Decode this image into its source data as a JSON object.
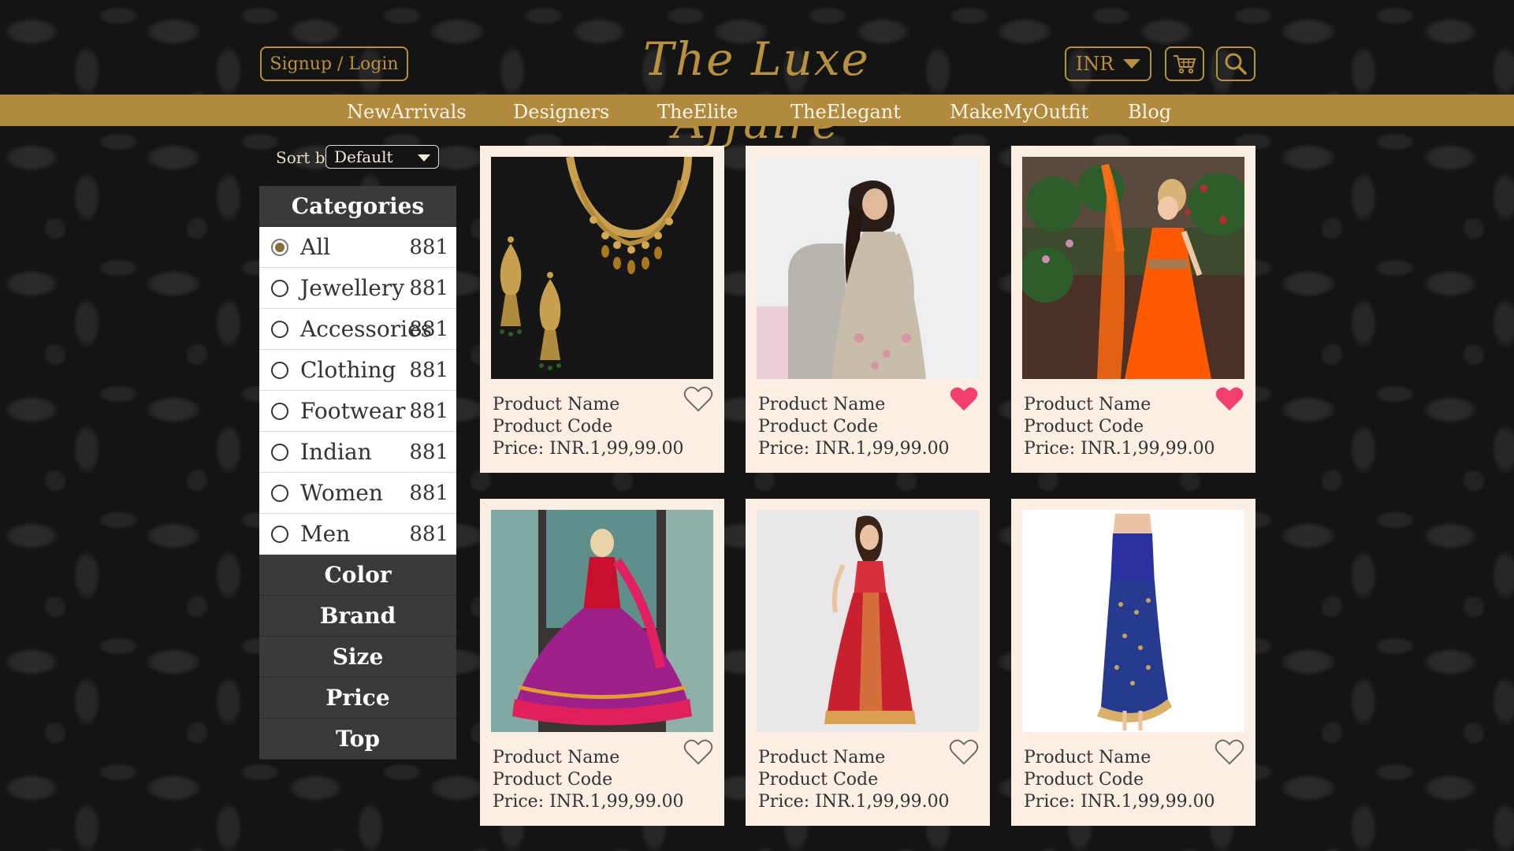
{
  "header": {
    "signup_label": "Signup / Login",
    "logo_text": "The Luxe Affaire",
    "currency": "INR"
  },
  "nav": {
    "items": [
      "NewArrivals",
      "Designers",
      "TheElite",
      "TheElegant",
      "MakeMyOutfit",
      "Blog"
    ]
  },
  "sort": {
    "label": "Sort by",
    "value": "Default"
  },
  "sidebar": {
    "categories_title": "Categories",
    "categories": [
      {
        "label": "All",
        "count": "881",
        "selected": true
      },
      {
        "label": "Jewellery",
        "count": "881",
        "selected": false
      },
      {
        "label": "Accessories",
        "count": "881",
        "selected": false
      },
      {
        "label": "Clothing",
        "count": "881",
        "selected": false
      },
      {
        "label": "Footwear",
        "count": "881",
        "selected": false
      },
      {
        "label": "Indian",
        "count": "881",
        "selected": false
      },
      {
        "label": "Women",
        "count": "881",
        "selected": false
      },
      {
        "label": "Men",
        "count": "881",
        "selected": false
      }
    ],
    "filters": [
      "Color",
      "Brand",
      "Size",
      "Price",
      "Top"
    ]
  },
  "products": [
    {
      "name": "Product Name",
      "code": "Product Code",
      "price": "Price: INR.1,99,99.00",
      "favorited": false,
      "image": "gold-necklace-earrings"
    },
    {
      "name": "Product Name",
      "code": "Product Code",
      "price": "Price: INR.1,99,99.00",
      "favorited": true,
      "image": "woman-grey-gown-chair"
    },
    {
      "name": "Product Name",
      "code": "Product Code",
      "price": "Price: INR.1,99,99.00",
      "favorited": true,
      "image": "woman-orange-dress-garden"
    },
    {
      "name": "Product Name",
      "code": "Product Code",
      "price": "Price: INR.1,99,99.00",
      "favorited": false,
      "image": "girl-pink-anarkali"
    },
    {
      "name": "Product Name",
      "code": "Product Code",
      "price": "Price: INR.1,99,99.00",
      "favorited": false,
      "image": "woman-red-lehenga"
    },
    {
      "name": "Product Name",
      "code": "Product Code",
      "price": "Price: INR.1,99,99.00",
      "favorited": false,
      "image": "blue-gold-gown"
    }
  ],
  "colors": {
    "gold": "#b8913f",
    "navbar": "#b08a3e",
    "card_bg": "#fbeee3",
    "heart_active": "#f23f6e"
  }
}
